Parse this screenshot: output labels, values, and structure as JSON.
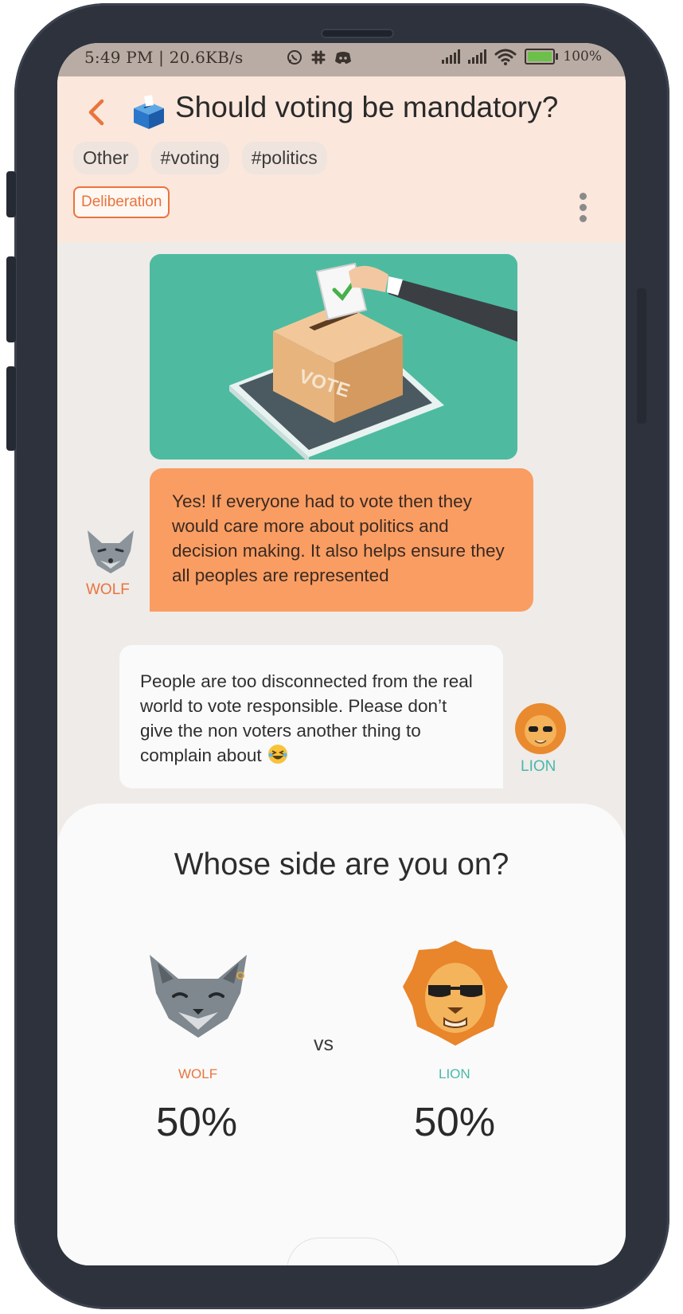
{
  "status_bar": {
    "time_and_speed": "5:49 PM | 20.6KB/s",
    "battery": "100%",
    "icons": [
      "whatsapp-icon",
      "slack-icon",
      "discord-icon",
      "signal-icon",
      "signal-icon",
      "wifi-icon",
      "battery-icon"
    ]
  },
  "header": {
    "title": "Should voting be mandatory?",
    "title_icon": "ballot-box-icon",
    "tags": [
      "Other",
      "#voting",
      "#politics"
    ],
    "badge": "Deliberation"
  },
  "messages": [
    {
      "author": "WOLF",
      "text": "Yes! If everyone had to vote then they would care more about  politics and decision making. It also helps ensure they all peoples are represented"
    },
    {
      "author": "LION",
      "text": "People are too disconnected from the real world to vote responsible. Please don’t give the non voters another thing to complain about"
    }
  ],
  "poll": {
    "title": "Whose side are you on?",
    "vs": "vs",
    "left": {
      "name": "WOLF",
      "percent": "50%"
    },
    "right": {
      "name": "LION",
      "percent": "50%"
    }
  },
  "image": {
    "box_label": "VOTE"
  },
  "colors": {
    "accent": "#e9743d",
    "wolf_bubble": "#fa9d62",
    "lion": "#49b8aa",
    "header_bg": "#fbe7dc",
    "screen_bg": "#efebe8"
  }
}
